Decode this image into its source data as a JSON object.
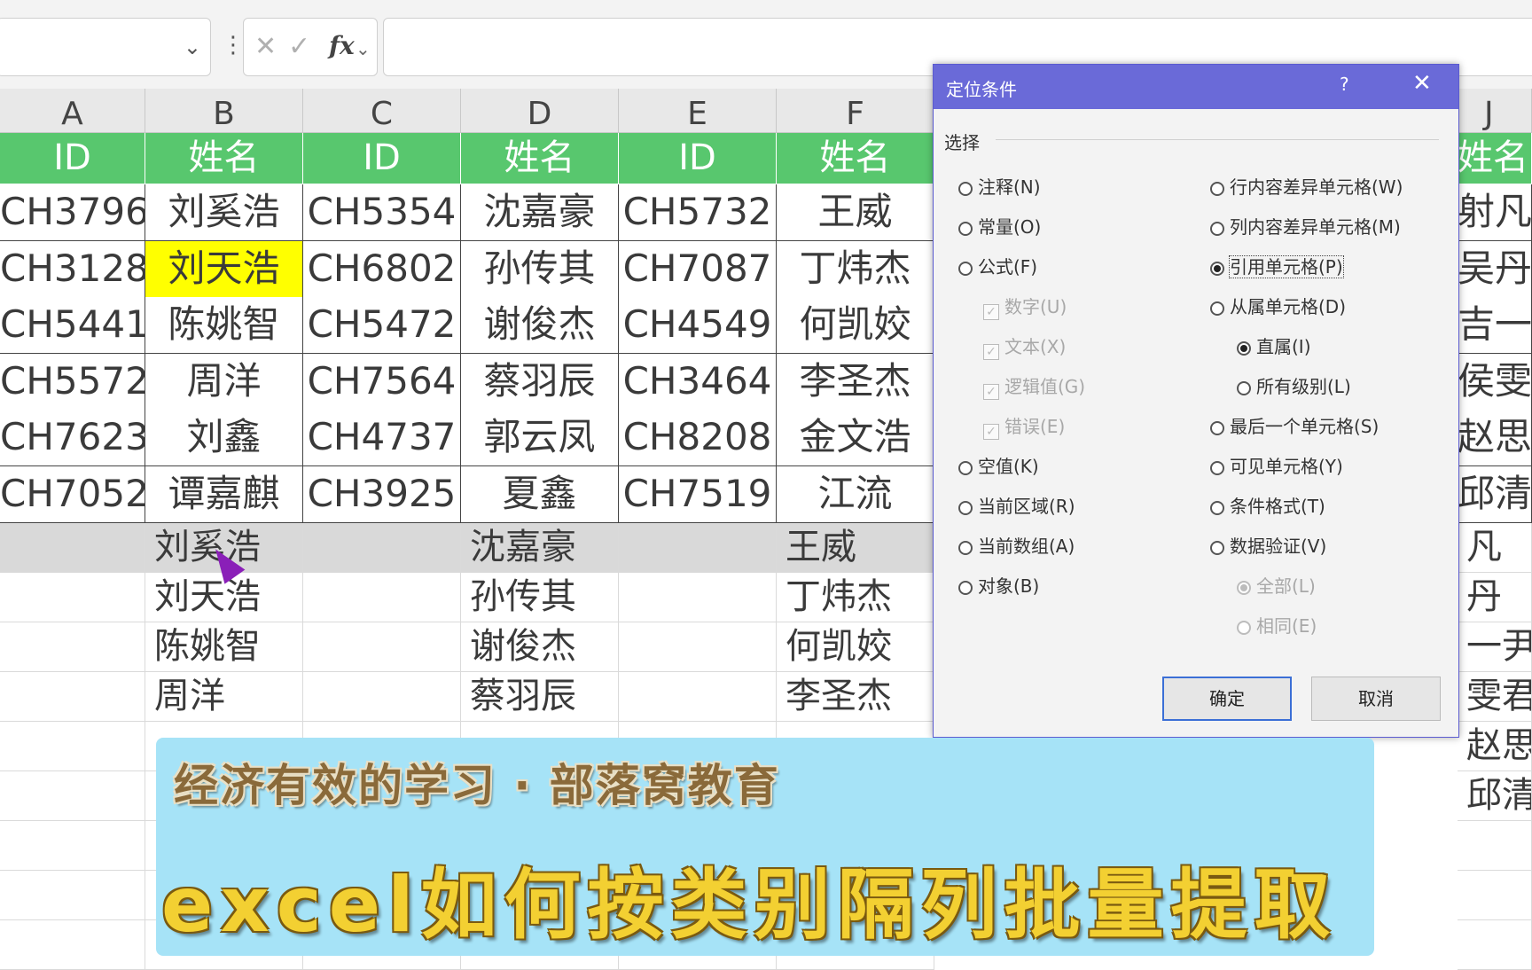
{
  "formula_bar": {
    "name_box_value": "",
    "fx_label": "fx",
    "formula_value": ""
  },
  "columns": [
    "A",
    "B",
    "C",
    "D",
    "E",
    "F",
    "J"
  ],
  "table": {
    "header": [
      "ID",
      "姓名",
      "ID",
      "姓名",
      "ID",
      "姓名",
      "姓名"
    ],
    "rows": [
      [
        "CH3796",
        "刘奚浩",
        "CH5354",
        "沈嘉豪",
        "CH5732",
        "王威",
        "射凡"
      ],
      [
        "CH3128",
        "刘天浩",
        "CH6802",
        "孙传其",
        "CH7087",
        "丁炜杰",
        "吴丹"
      ],
      [
        "CH5441",
        "陈姚智",
        "CH5472",
        "谢俊杰",
        "CH4549",
        "何凯姣",
        "吉一尹"
      ],
      [
        "CH5572",
        "周洋",
        "CH7564",
        "蔡羽辰",
        "CH3464",
        "李圣杰",
        "侯雯君"
      ],
      [
        "CH7623",
        "刘鑫",
        "CH4737",
        "郭云凤",
        "CH8208",
        "金文浩",
        "赵思佳"
      ],
      [
        "CH7052",
        "谭嘉麒",
        "CH3925",
        "夏鑫",
        "CH7519",
        "江流",
        "邱清怡"
      ]
    ]
  },
  "extracted": {
    "col_b": [
      "刘奚浩",
      "刘天浩",
      "陈姚智",
      "周洋"
    ],
    "col_d": [
      "沈嘉豪",
      "孙传其",
      "谢俊杰",
      "蔡羽辰"
    ],
    "col_f": [
      "王威",
      "丁炜杰",
      "何凯姣",
      "李圣杰"
    ],
    "col_j": [
      "凡",
      "丹",
      "一尹",
      "雯君",
      "赵思佳",
      "邱清怡"
    ]
  },
  "dialog": {
    "title": "定位条件",
    "help": "?",
    "close": "✕",
    "group_label": "选择",
    "left_options": [
      "注释(N)",
      "常量(O)",
      "公式(F)",
      "数字(U)",
      "文本(X)",
      "逻辑值(G)",
      "错误(E)",
      "空值(K)",
      "当前区域(R)",
      "当前数组(A)",
      "对象(B)"
    ],
    "right_options": [
      "行内容差异单元格(W)",
      "列内容差异单元格(M)",
      "引用单元格(P)",
      "从属单元格(D)",
      "直属(I)",
      "所有级别(L)",
      "最后一个单元格(S)",
      "可见单元格(Y)",
      "条件格式(T)",
      "数据验证(V)",
      "全部(L)",
      "相同(E)"
    ],
    "selected": "引用单元格(P)",
    "ok": "确定",
    "cancel": "取消"
  },
  "banner": {
    "line1": "经济有效的学习 · 部落窝教育",
    "line2": "excel如何按类别隔列批量提取"
  },
  "colors": {
    "header_green": "#58c76e",
    "highlight_yellow": "#ffff00",
    "dialog_title": "#6a6ad8",
    "banner_bg": "#a6e3f7"
  }
}
